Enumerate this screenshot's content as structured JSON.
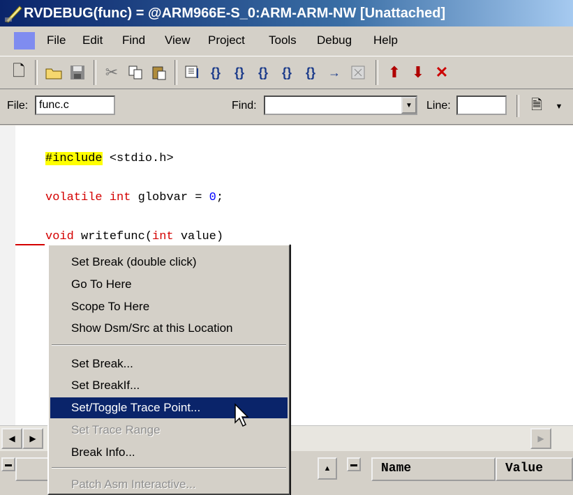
{
  "window": {
    "title": "RVDEBUG(func) = @ARM966E-S_0:ARM-ARM-NW [Unattached]"
  },
  "menu": [
    "File",
    "Edit",
    "Find",
    "View",
    "Project",
    "Tools",
    "Debug",
    "Help"
  ],
  "toolbar_icons": [
    "new-file-icon",
    "open-folder-icon",
    "save-icon",
    "cut-icon",
    "copy-icon",
    "paste-icon",
    "run-icon",
    "step-icon",
    "step-over-icon",
    "step-into-icon",
    "step-out-icon",
    "step-return-icon",
    "run-to-icon",
    "stop-icon",
    "up-arrow-icon",
    "down-arrow-icon",
    "delete-icon"
  ],
  "findbar": {
    "file_label": "File:",
    "file_value": "func.c",
    "find_label": "Find:",
    "find_value": "",
    "line_label": "Line:",
    "line_value": ""
  },
  "code": {
    "line1_directive": "#include",
    "line1_rest": " <stdio.h>",
    "line2_kw1": "volatile",
    "line2_sp1": " ",
    "line2_kw2": "int",
    "line2_rest": " globvar = ",
    "line2_num": "0",
    "line2_end": ";",
    "line3_kw1": "void",
    "line3_mid": " writefunc(",
    "line3_kw2": "int",
    "line3_end": " value)"
  },
  "context_menu": {
    "items": [
      {
        "label": "Set Break (double click)",
        "state": "normal"
      },
      {
        "label": "Go To Here",
        "state": "normal"
      },
      {
        "label": "Scope To Here",
        "state": "normal"
      },
      {
        "label": "Show Dsm/Src at this Location",
        "state": "normal"
      },
      {
        "label": "Set Break...",
        "state": "normal"
      },
      {
        "label": "Set BreakIf...",
        "state": "normal"
      },
      {
        "label": "Set/Toggle Trace Point...",
        "state": "selected"
      },
      {
        "label": "Set Trace Range",
        "state": "disabled"
      },
      {
        "label": "Break Info...",
        "state": "normal"
      },
      {
        "label": "Patch Asm Interactive...",
        "state": "disabled"
      }
    ]
  },
  "lower_panes": {
    "col_name": "Name",
    "col_value": "Value"
  }
}
